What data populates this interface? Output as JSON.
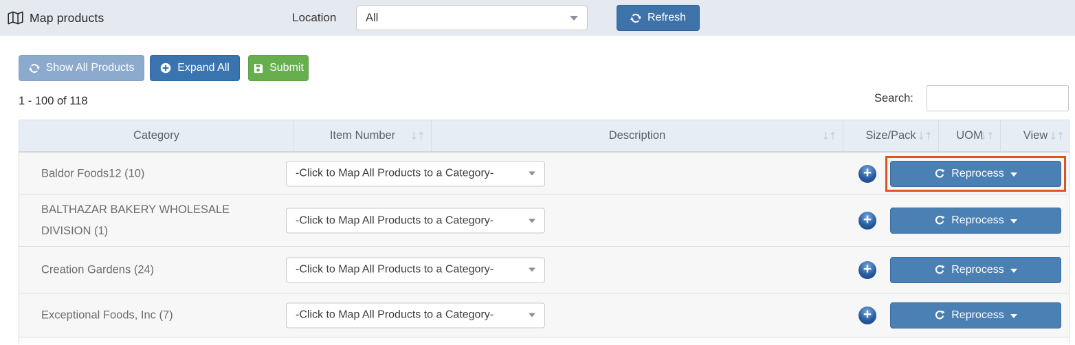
{
  "topbar": {
    "title": "Map products",
    "location_label": "Location",
    "location_value": "All",
    "refresh_label": "Refresh"
  },
  "toolbar": {
    "show_all_label": "Show All Products",
    "expand_all_label": "Expand All",
    "submit_label": "Submit"
  },
  "results_summary": "1 - 100 of 118",
  "search": {
    "label": "Search:",
    "value": ""
  },
  "table": {
    "columns": [
      {
        "label": "Category",
        "sortable": false
      },
      {
        "label": "Item Number",
        "sortable": true
      },
      {
        "label": "Description",
        "sortable": true
      },
      {
        "label": "Size/Pack",
        "sortable": true
      },
      {
        "label": "UOM",
        "sortable": true
      },
      {
        "label": "View",
        "sortable": true
      }
    ],
    "map_dropdown_value": "-Click to Map All Products to a Category-",
    "reprocess_label": "Reprocess",
    "rows": [
      {
        "category": "Baldor Foods12 (10)",
        "highlighted": true
      },
      {
        "category": "BALTHAZAR BAKERY WHOLESALE DIVISION (1)",
        "highlighted": false
      },
      {
        "category": "Creation Gardens (24)",
        "highlighted": false
      },
      {
        "category": "Exceptional Foods, Inc (7)",
        "highlighted": false
      }
    ]
  },
  "icons": {
    "sort": "↓↑",
    "plus": "+"
  },
  "colors": {
    "accent_blue": "#3e73a9",
    "reprocess_blue": "#4b80b4",
    "light_blue": "#8caacd",
    "green": "#67ae4e",
    "highlight_orange": "#e1521d",
    "topbar_bg": "#e5e9f0",
    "header_bg": "#e7edf4",
    "row_bg": "#f7f7f7"
  }
}
